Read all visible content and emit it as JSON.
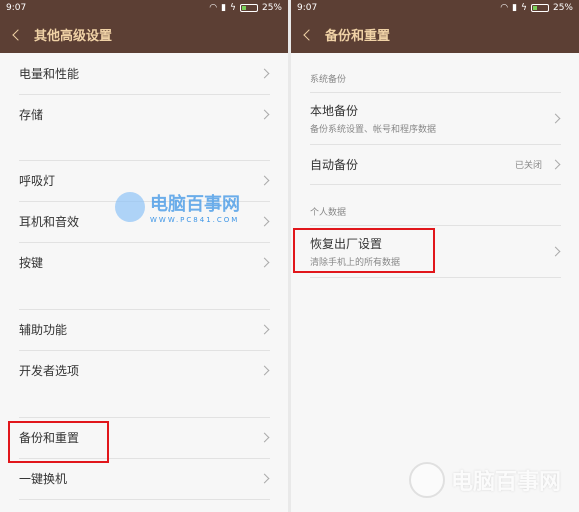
{
  "left": {
    "status": {
      "time": "9:07",
      "battery": "25%"
    },
    "title": "其他高级设置",
    "items": [
      "电量和性能",
      "存储",
      "呼吸灯",
      "耳机和音效",
      "按键",
      "辅助功能",
      "开发者选项",
      "备份和重置",
      "一键换机"
    ]
  },
  "right": {
    "status": {
      "time": "9:07",
      "battery": "25%"
    },
    "title": "备份和重置",
    "section1": "系统备份",
    "local_backup": {
      "label": "本地备份",
      "sub": "备份系统设置、帐号和程序数据"
    },
    "auto_backup": {
      "label": "自动备份",
      "value": "已关闭"
    },
    "section2": "个人数据",
    "factory_reset": {
      "label": "恢复出厂设置",
      "sub": "清除手机上的所有数据"
    }
  },
  "watermark": {
    "text": "电脑百事网",
    "url": "WWW.PC841.COM"
  },
  "colors": {
    "header": "#5c3f34",
    "title": "#f0d2a6",
    "highlight": "#e1161b"
  },
  "battery_level": 0.25
}
